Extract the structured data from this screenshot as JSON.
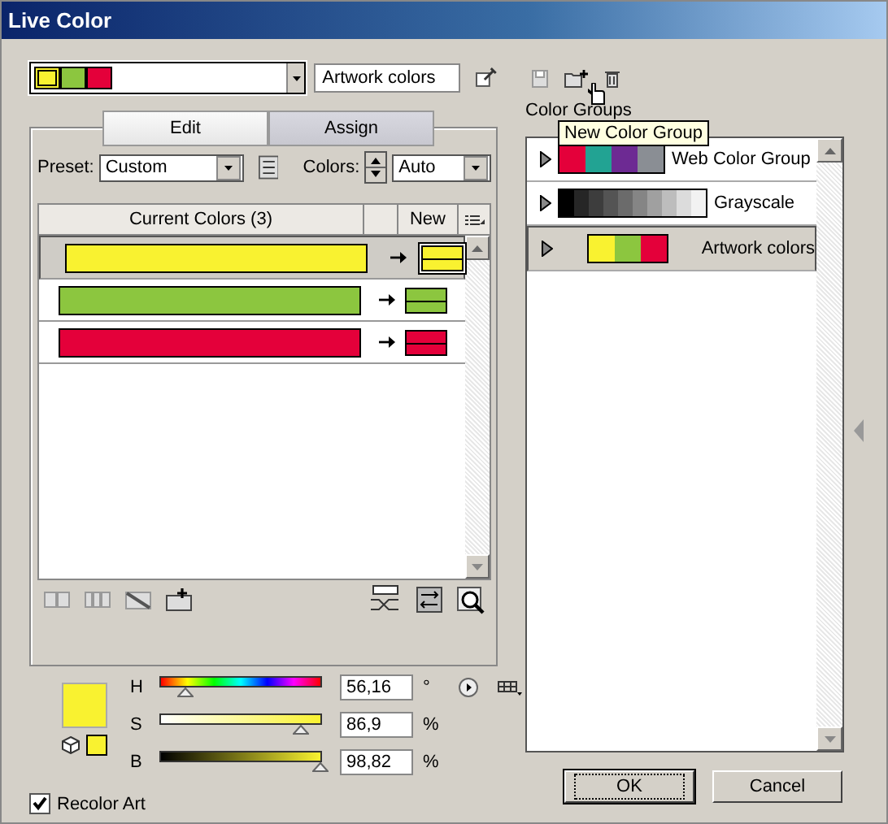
{
  "window": {
    "title": "Live Color"
  },
  "color_group_dropdown": {
    "swatches": [
      {
        "color": "#f9f230"
      },
      {
        "color": "#8cc63f"
      },
      {
        "color": "#e4003a"
      }
    ]
  },
  "group_name_field": {
    "value": "Artwork colors"
  },
  "group_toolbar": {
    "tooltip": "New Color Group"
  },
  "tabs": [
    {
      "label": "Edit",
      "selected": true
    },
    {
      "label": "Assign",
      "selected": false
    }
  ],
  "preset": {
    "label": "Preset:",
    "value": "Custom"
  },
  "colors": {
    "label": "Colors:",
    "value": "Auto"
  },
  "table": {
    "columns": [
      "Current Colors (3)",
      "New"
    ],
    "rows": [
      {
        "color": "#f9f230",
        "selected": true
      },
      {
        "color": "#8cc63f",
        "selected": false
      },
      {
        "color": "#e4003a",
        "selected": false
      }
    ]
  },
  "color_controls": {
    "color": "#f9f230",
    "sliders": [
      {
        "label": "H",
        "kind": "hue",
        "level": 0.16,
        "value": "56,16",
        "unit": "°"
      },
      {
        "label": "S",
        "kind": "saturation",
        "level": 0.87,
        "value": "86,9",
        "unit": "%"
      },
      {
        "label": "B",
        "kind": "brightness",
        "level": 0.99,
        "value": "98,82",
        "unit": "%"
      }
    ]
  },
  "recolor_art": {
    "label": "Recolor Art",
    "checked": true
  },
  "color_groups": {
    "label": "Color Groups",
    "groups": [
      {
        "name": "Web Color Group",
        "selected": false,
        "swatches": [
          {
            "color": "#e4003a"
          },
          {
            "color": "#22a393"
          },
          {
            "color": "#6d2a93"
          },
          {
            "color": "#8a8e94"
          }
        ]
      },
      {
        "name": "Grayscale",
        "selected": false,
        "swatches": [
          {
            "color": "#000000"
          },
          {
            "color": "#262626"
          },
          {
            "color": "#3d3d3d"
          },
          {
            "color": "#545454"
          },
          {
            "color": "#6b6b6b"
          },
          {
            "color": "#858585"
          },
          {
            "color": "#a0a0a0"
          },
          {
            "color": "#bdbdbd"
          },
          {
            "color": "#dcdcdc"
          },
          {
            "color": "#f2f2f2"
          }
        ]
      },
      {
        "name": "Artwork colors",
        "selected": true,
        "swatches": [
          {
            "color": "#f9f230"
          },
          {
            "color": "#8cc63f"
          },
          {
            "color": "#e4003a"
          }
        ]
      }
    ]
  },
  "buttons": [
    {
      "label": "OK",
      "default": true
    },
    {
      "label": "Cancel",
      "default": false
    }
  ]
}
